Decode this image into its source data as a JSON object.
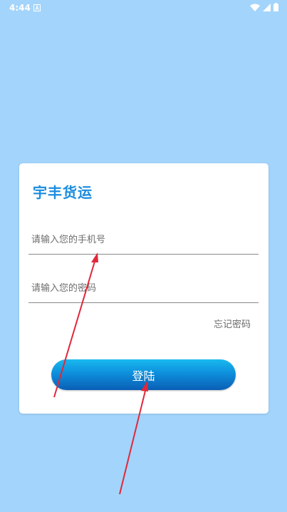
{
  "status_bar": {
    "time": "4:44",
    "icons": [
      "notification-a-icon",
      "wifi-icon",
      "signal-icon",
      "battery-icon"
    ]
  },
  "login": {
    "title": "宇丰货运",
    "phone_placeholder": "请输入您的手机号",
    "phone_value": "",
    "password_placeholder": "请输入您的密码",
    "password_value": "",
    "forgot_label": "忘记密码",
    "submit_label": "登陆"
  },
  "colors": {
    "background": "#a3d4fb",
    "title": "#1b8de0",
    "button_top": "#18b9ef",
    "button_bottom": "#0a5fb5",
    "annotation_arrow": "#e0283a"
  }
}
